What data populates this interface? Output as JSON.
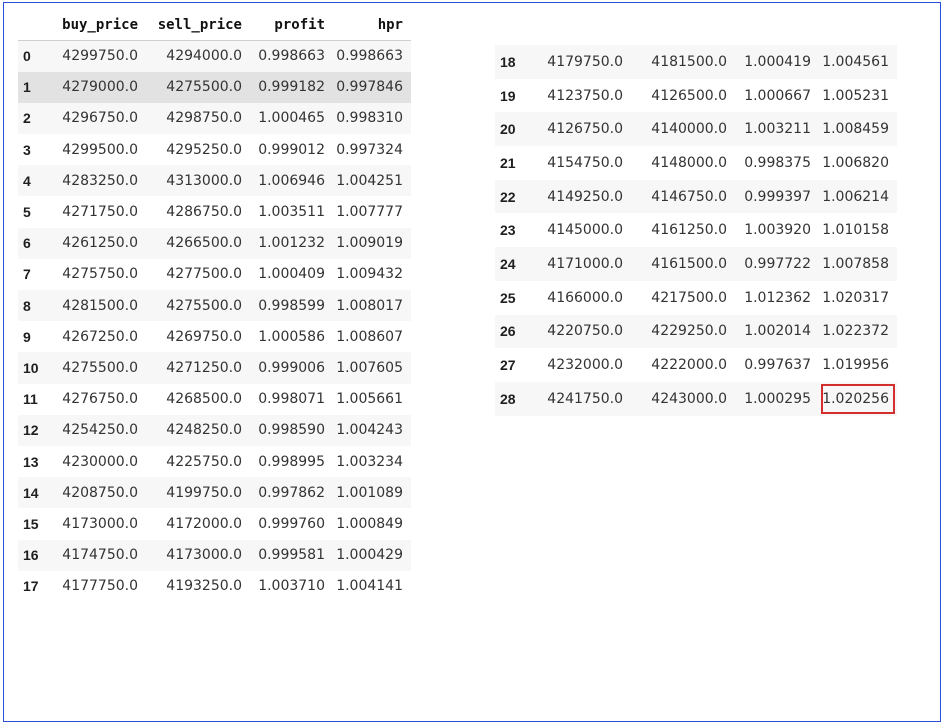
{
  "columns": [
    "buy_price",
    "sell_price",
    "profit",
    "hpr"
  ],
  "left_rows": [
    {
      "idx": "0",
      "buy": "4299750.0",
      "sell": "4294000.0",
      "profit": "0.998663",
      "hpr": "0.998663"
    },
    {
      "idx": "1",
      "buy": "4279000.0",
      "sell": "4275500.0",
      "profit": "0.999182",
      "hpr": "0.997846"
    },
    {
      "idx": "2",
      "buy": "4296750.0",
      "sell": "4298750.0",
      "profit": "1.000465",
      "hpr": "0.998310"
    },
    {
      "idx": "3",
      "buy": "4299500.0",
      "sell": "4295250.0",
      "profit": "0.999012",
      "hpr": "0.997324"
    },
    {
      "idx": "4",
      "buy": "4283250.0",
      "sell": "4313000.0",
      "profit": "1.006946",
      "hpr": "1.004251"
    },
    {
      "idx": "5",
      "buy": "4271750.0",
      "sell": "4286750.0",
      "profit": "1.003511",
      "hpr": "1.007777"
    },
    {
      "idx": "6",
      "buy": "4261250.0",
      "sell": "4266500.0",
      "profit": "1.001232",
      "hpr": "1.009019"
    },
    {
      "idx": "7",
      "buy": "4275750.0",
      "sell": "4277500.0",
      "profit": "1.000409",
      "hpr": "1.009432"
    },
    {
      "idx": "8",
      "buy": "4281500.0",
      "sell": "4275500.0",
      "profit": "0.998599",
      "hpr": "1.008017"
    },
    {
      "idx": "9",
      "buy": "4267250.0",
      "sell": "4269750.0",
      "profit": "1.000586",
      "hpr": "1.008607"
    },
    {
      "idx": "10",
      "buy": "4275500.0",
      "sell": "4271250.0",
      "profit": "0.999006",
      "hpr": "1.007605"
    },
    {
      "idx": "11",
      "buy": "4276750.0",
      "sell": "4268500.0",
      "profit": "0.998071",
      "hpr": "1.005661"
    },
    {
      "idx": "12",
      "buy": "4254250.0",
      "sell": "4248250.0",
      "profit": "0.998590",
      "hpr": "1.004243"
    },
    {
      "idx": "13",
      "buy": "4230000.0",
      "sell": "4225750.0",
      "profit": "0.998995",
      "hpr": "1.003234"
    },
    {
      "idx": "14",
      "buy": "4208750.0",
      "sell": "4199750.0",
      "profit": "0.997862",
      "hpr": "1.001089"
    },
    {
      "idx": "15",
      "buy": "4173000.0",
      "sell": "4172000.0",
      "profit": "0.999760",
      "hpr": "1.000849"
    },
    {
      "idx": "16",
      "buy": "4174750.0",
      "sell": "4173000.0",
      "profit": "0.999581",
      "hpr": "1.000429"
    },
    {
      "idx": "17",
      "buy": "4177750.0",
      "sell": "4193250.0",
      "profit": "1.003710",
      "hpr": "1.004141"
    }
  ],
  "right_rows": [
    {
      "idx": "18",
      "buy": "4179750.0",
      "sell": "4181500.0",
      "profit": "1.000419",
      "hpr": "1.004561"
    },
    {
      "idx": "19",
      "buy": "4123750.0",
      "sell": "4126500.0",
      "profit": "1.000667",
      "hpr": "1.005231"
    },
    {
      "idx": "20",
      "buy": "4126750.0",
      "sell": "4140000.0",
      "profit": "1.003211",
      "hpr": "1.008459"
    },
    {
      "idx": "21",
      "buy": "4154750.0",
      "sell": "4148000.0",
      "profit": "0.998375",
      "hpr": "1.006820"
    },
    {
      "idx": "22",
      "buy": "4149250.0",
      "sell": "4146750.0",
      "profit": "0.999397",
      "hpr": "1.006214"
    },
    {
      "idx": "23",
      "buy": "4145000.0",
      "sell": "4161250.0",
      "profit": "1.003920",
      "hpr": "1.010158"
    },
    {
      "idx": "24",
      "buy": "4171000.0",
      "sell": "4161500.0",
      "profit": "0.997722",
      "hpr": "1.007858"
    },
    {
      "idx": "25",
      "buy": "4166000.0",
      "sell": "4217500.0",
      "profit": "1.012362",
      "hpr": "1.020317"
    },
    {
      "idx": "26",
      "buy": "4220750.0",
      "sell": "4229250.0",
      "profit": "1.002014",
      "hpr": "1.022372"
    },
    {
      "idx": "27",
      "buy": "4232000.0",
      "sell": "4222000.0",
      "profit": "0.997637",
      "hpr": "1.019956"
    },
    {
      "idx": "28",
      "buy": "4241750.0",
      "sell": "4243000.0",
      "profit": "1.000295",
      "hpr": "1.020256"
    }
  ],
  "highlight": {
    "border_color": "#2b50d8",
    "box_color": "#d32f2f"
  }
}
